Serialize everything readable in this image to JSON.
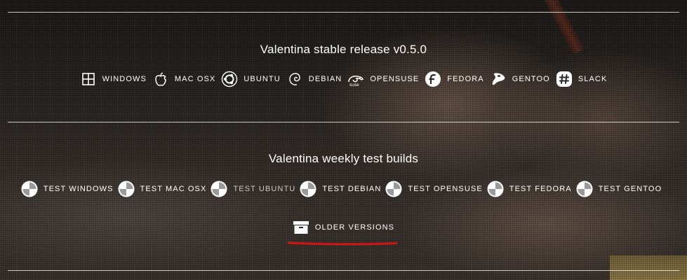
{
  "stable": {
    "heading": "Valentina stable release v0.5.0",
    "items": [
      {
        "label": "WINDOWS",
        "icon": "windows-icon"
      },
      {
        "label": "MAC OSX",
        "icon": "apple-icon"
      },
      {
        "label": "UBUNTU",
        "icon": "ubuntu-icon"
      },
      {
        "label": "DEBIAN",
        "icon": "debian-icon"
      },
      {
        "label": "OPENSUSE",
        "icon": "opensuse-icon"
      },
      {
        "label": "FEDORA",
        "icon": "fedora-icon"
      },
      {
        "label": "GENTOO",
        "icon": "gentoo-icon"
      },
      {
        "label": "SLACK",
        "icon": "slack-icon"
      }
    ]
  },
  "weekly": {
    "heading": "Valentina weekly test builds",
    "items": [
      {
        "label": "TEST WINDOWS",
        "icon": "test-build-icon"
      },
      {
        "label": "TEST MAC OSX",
        "icon": "test-build-icon"
      },
      {
        "label": "TEST UBUNTU",
        "icon": "test-build-icon"
      },
      {
        "label": "TEST DEBIAN",
        "icon": "test-build-icon"
      },
      {
        "label": "TEST OPENSUSE",
        "icon": "test-build-icon"
      },
      {
        "label": "TEST FEDORA",
        "icon": "test-build-icon"
      },
      {
        "label": "TEST GENTOO",
        "icon": "test-build-icon"
      }
    ]
  },
  "older": {
    "label": "OLDER VERSIONS",
    "icon": "archive-icon"
  },
  "colors": {
    "text": "#ffffff",
    "divider": "#ffffff",
    "annotation": "#d41414"
  }
}
